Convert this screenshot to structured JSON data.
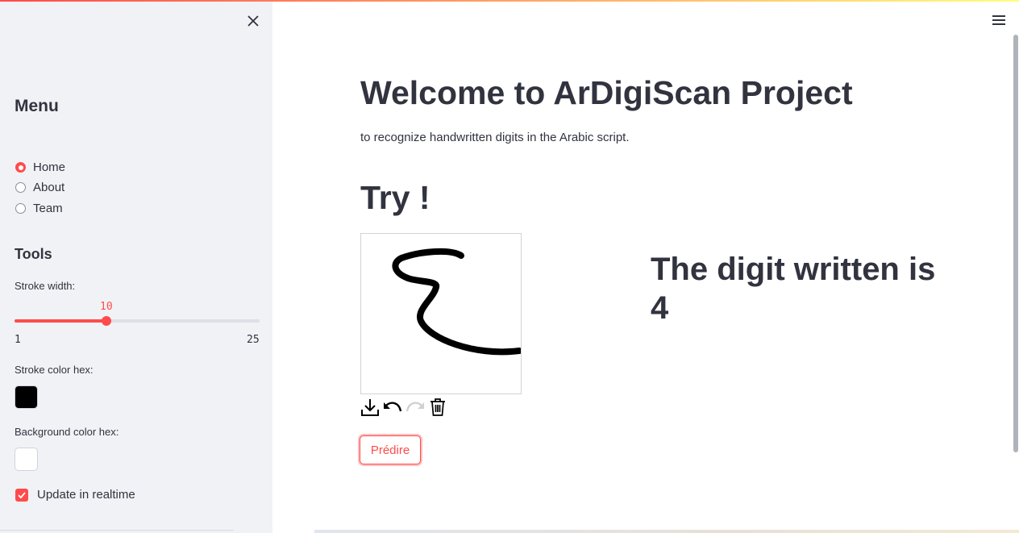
{
  "sidebar": {
    "menu_title": "Menu",
    "menu_items": [
      "Home",
      "About",
      "Team"
    ],
    "selected_menu_index": 0,
    "tools_title": "Tools",
    "stroke_width": {
      "label": "Stroke width:",
      "value": "10",
      "min": "1",
      "max": "25"
    },
    "stroke_color": {
      "label": "Stroke color hex:",
      "value": "#000000"
    },
    "background_color": {
      "label": "Background color hex:",
      "value": "#ffffff"
    },
    "realtime": {
      "label": "Update in realtime",
      "checked": true
    }
  },
  "main": {
    "title": "Welcome to ArDigiScan Project",
    "subtitle": "to recognize handwritten digits in the Arabic script.",
    "try_heading": "Try !",
    "predict_button": "Prédire",
    "result": "The digit written is 4"
  },
  "icons": {
    "close": "close-icon",
    "menu": "hamburger-icon",
    "canvas_tools": [
      "download-icon",
      "undo-icon",
      "redo-icon",
      "trash-icon"
    ]
  },
  "colors": {
    "accent": "#ff4b4b",
    "sidebar_bg": "#f0f2f6",
    "text": "#31333f"
  }
}
